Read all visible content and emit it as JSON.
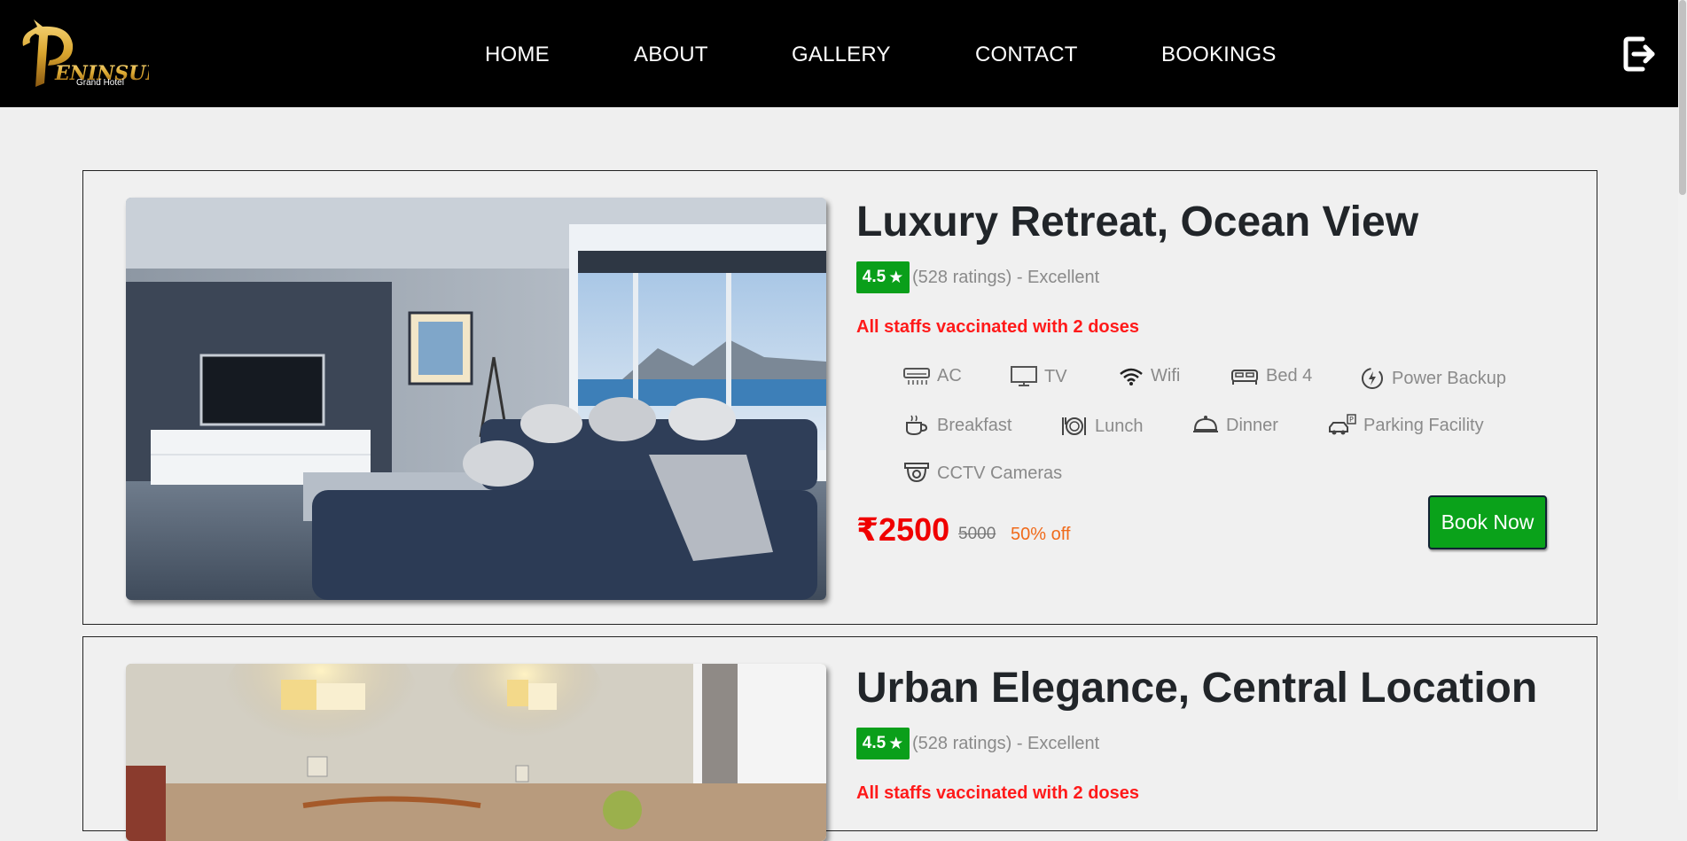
{
  "header": {
    "logo_text": "PENINSULA",
    "logo_subtext": "Grand Hotel",
    "nav": [
      "HOME",
      "ABOUT",
      "GALLERY",
      "CONTACT",
      "BOOKINGS"
    ],
    "logout_icon": "logout-icon"
  },
  "colors": {
    "header_bg": "#000000",
    "page_bg": "#efefef",
    "rating_green": "#0a9f1a",
    "price_red": "#f00000",
    "discount_orange": "#f06a1a",
    "button_green": "#0aa21a"
  },
  "rooms": [
    {
      "title": "Luxury Retreat, Ocean View",
      "rating": "4.5",
      "star": "★",
      "rating_text": "(528 ratings) - Excellent",
      "notice": "All staffs vaccinated with 2 doses",
      "amenities": [
        {
          "label": "AC",
          "icon": "ac-icon"
        },
        {
          "label": "TV",
          "icon": "tv-icon"
        },
        {
          "label": "Wifi",
          "icon": "wifi-icon"
        },
        {
          "label": "Bed 4",
          "icon": "bed-icon"
        },
        {
          "label": "Power Backup",
          "icon": "power-backup-icon"
        },
        {
          "label": "Breakfast",
          "icon": "breakfast-icon"
        },
        {
          "label": "Lunch",
          "icon": "lunch-icon"
        },
        {
          "label": "Dinner",
          "icon": "dinner-icon"
        },
        {
          "label": "Parking Facility",
          "icon": "parking-icon"
        },
        {
          "label": "CCTV Cameras",
          "icon": "cctv-icon"
        }
      ],
      "price": "₹2500",
      "old_price": "5000",
      "discount": "50% off",
      "book_label": "Book Now"
    },
    {
      "title": "Urban Elegance, Central Location",
      "rating": "4.5",
      "star": "★",
      "rating_text": "(528 ratings) - Excellent",
      "notice": "All staffs vaccinated with 2 doses"
    }
  ]
}
